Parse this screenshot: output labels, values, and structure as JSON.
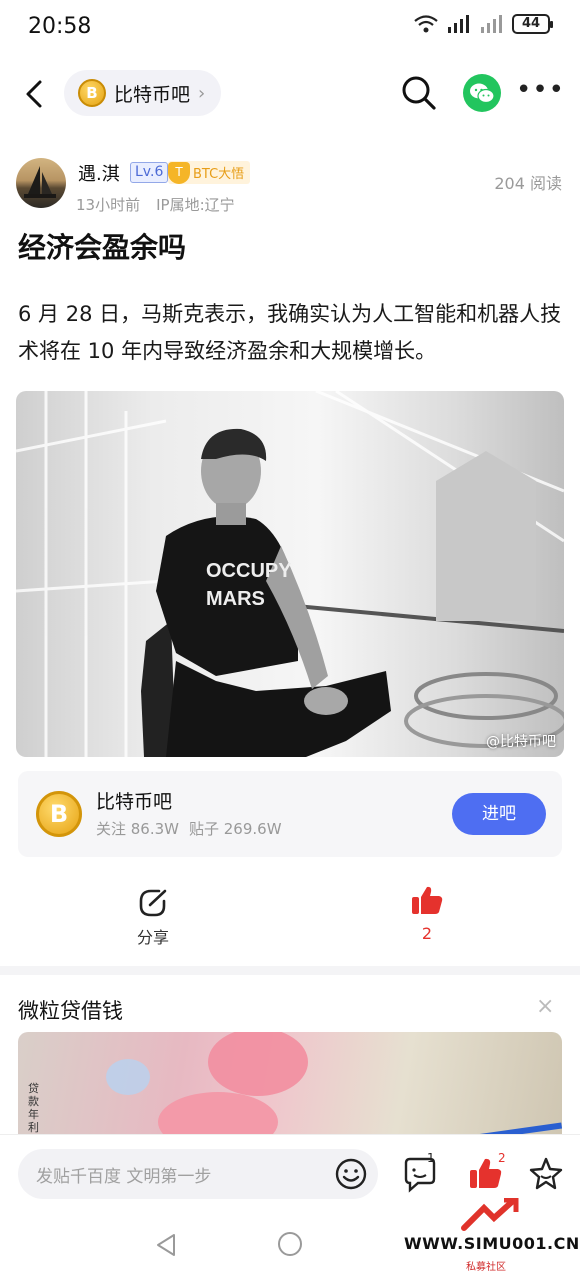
{
  "status_bar": {
    "time": "20:58",
    "battery": "44"
  },
  "nav": {
    "forum_name": "比特币吧",
    "coin_symbol": "B"
  },
  "author": {
    "name": "遇.淇",
    "level": "Lv.6",
    "title_badge": "BTC大悟",
    "time_ago": "13小时前",
    "ip_location": "IP属地:辽宁"
  },
  "post": {
    "reads": "204 阅读",
    "title": "经济会盈余吗",
    "body": "6 月 28 日，马斯克表示，我确实认为人工智能和机器人技术将在 10 年内导致经济盈余和大规模增长。",
    "image_watermark": "@比特币吧",
    "shirt_text_1": "OCCUPY",
    "shirt_text_2": "MARS"
  },
  "forum_card": {
    "name": "比特币吧",
    "followers": "关注 86.3W",
    "posts": "贴子 269.6W",
    "enter_label": "进吧"
  },
  "actions": {
    "share_label": "分享",
    "like_count": "2"
  },
  "ad": {
    "title": "微粒贷借钱",
    "close": "×",
    "vertical_text": "贷款年利"
  },
  "bottom_bar": {
    "placeholder": "发贴千百度 文明第一步",
    "reply_badge": "1",
    "like_badge": "2"
  },
  "watermark_site": {
    "url": "WWW.SIMU001.CN",
    "subtitle": "私募社区"
  },
  "colors": {
    "accent": "#4e6ef2",
    "like_red": "#e5322d",
    "wechat_green": "#22c55e",
    "coin_gold": "#e6a212"
  }
}
